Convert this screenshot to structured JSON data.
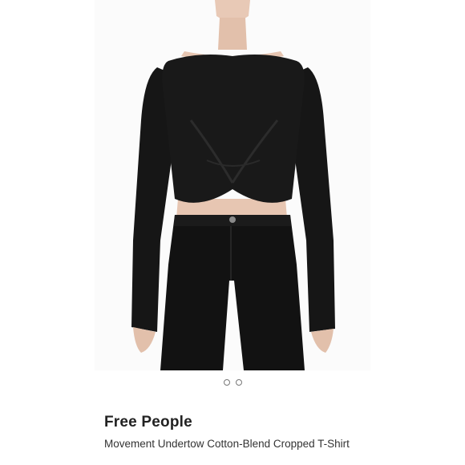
{
  "product": {
    "brand": "Free People",
    "title": "Movement Undertow Cotton-Blend Cropped T-Shirt"
  },
  "gallery": {
    "image_label": "Model wearing black twist-front cropped long-sleeve top with black jeans",
    "dots": [
      {
        "active": false
      },
      {
        "active": false
      }
    ]
  },
  "icons": {
    "favorite": "heart-outline-icon"
  },
  "colors": {
    "garment": "#161616",
    "skin": "#e8c9b6",
    "background": "#ffffff"
  }
}
